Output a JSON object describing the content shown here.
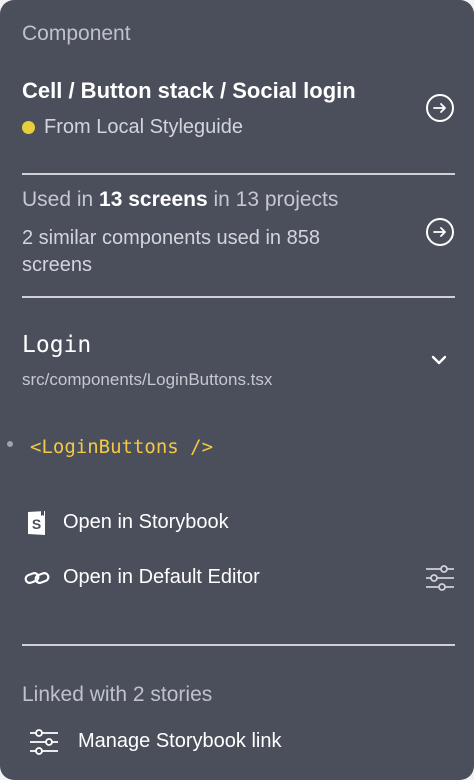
{
  "header": {
    "section_title": "Component"
  },
  "component": {
    "name": "Cell / Button stack / Social login",
    "source_label": "From Local Styleguide",
    "source_color": "#e6cf3a"
  },
  "usage": {
    "prefix": "Used in ",
    "screens_bold": "13 screens",
    "suffix": " in 13 projects",
    "similar_text": "2 similar components used in 858 screens"
  },
  "code_component": {
    "title": "Login",
    "file_path": "src/components/LoginButtons.tsx",
    "snippet": "<LoginButtons />"
  },
  "actions": {
    "open_storybook": "Open in Storybook",
    "open_editor": "Open in Default Editor"
  },
  "linked": {
    "text": "Linked with 2 stories",
    "manage_label": "Manage Storybook link"
  },
  "colors": {
    "panel_bg": "#4b4f5c",
    "code_highlight": "#f2c945"
  },
  "icons": [
    "arrow-right-circle-icon",
    "chevron-down-icon",
    "storybook-icon",
    "link-icon",
    "sliders-icon"
  ]
}
